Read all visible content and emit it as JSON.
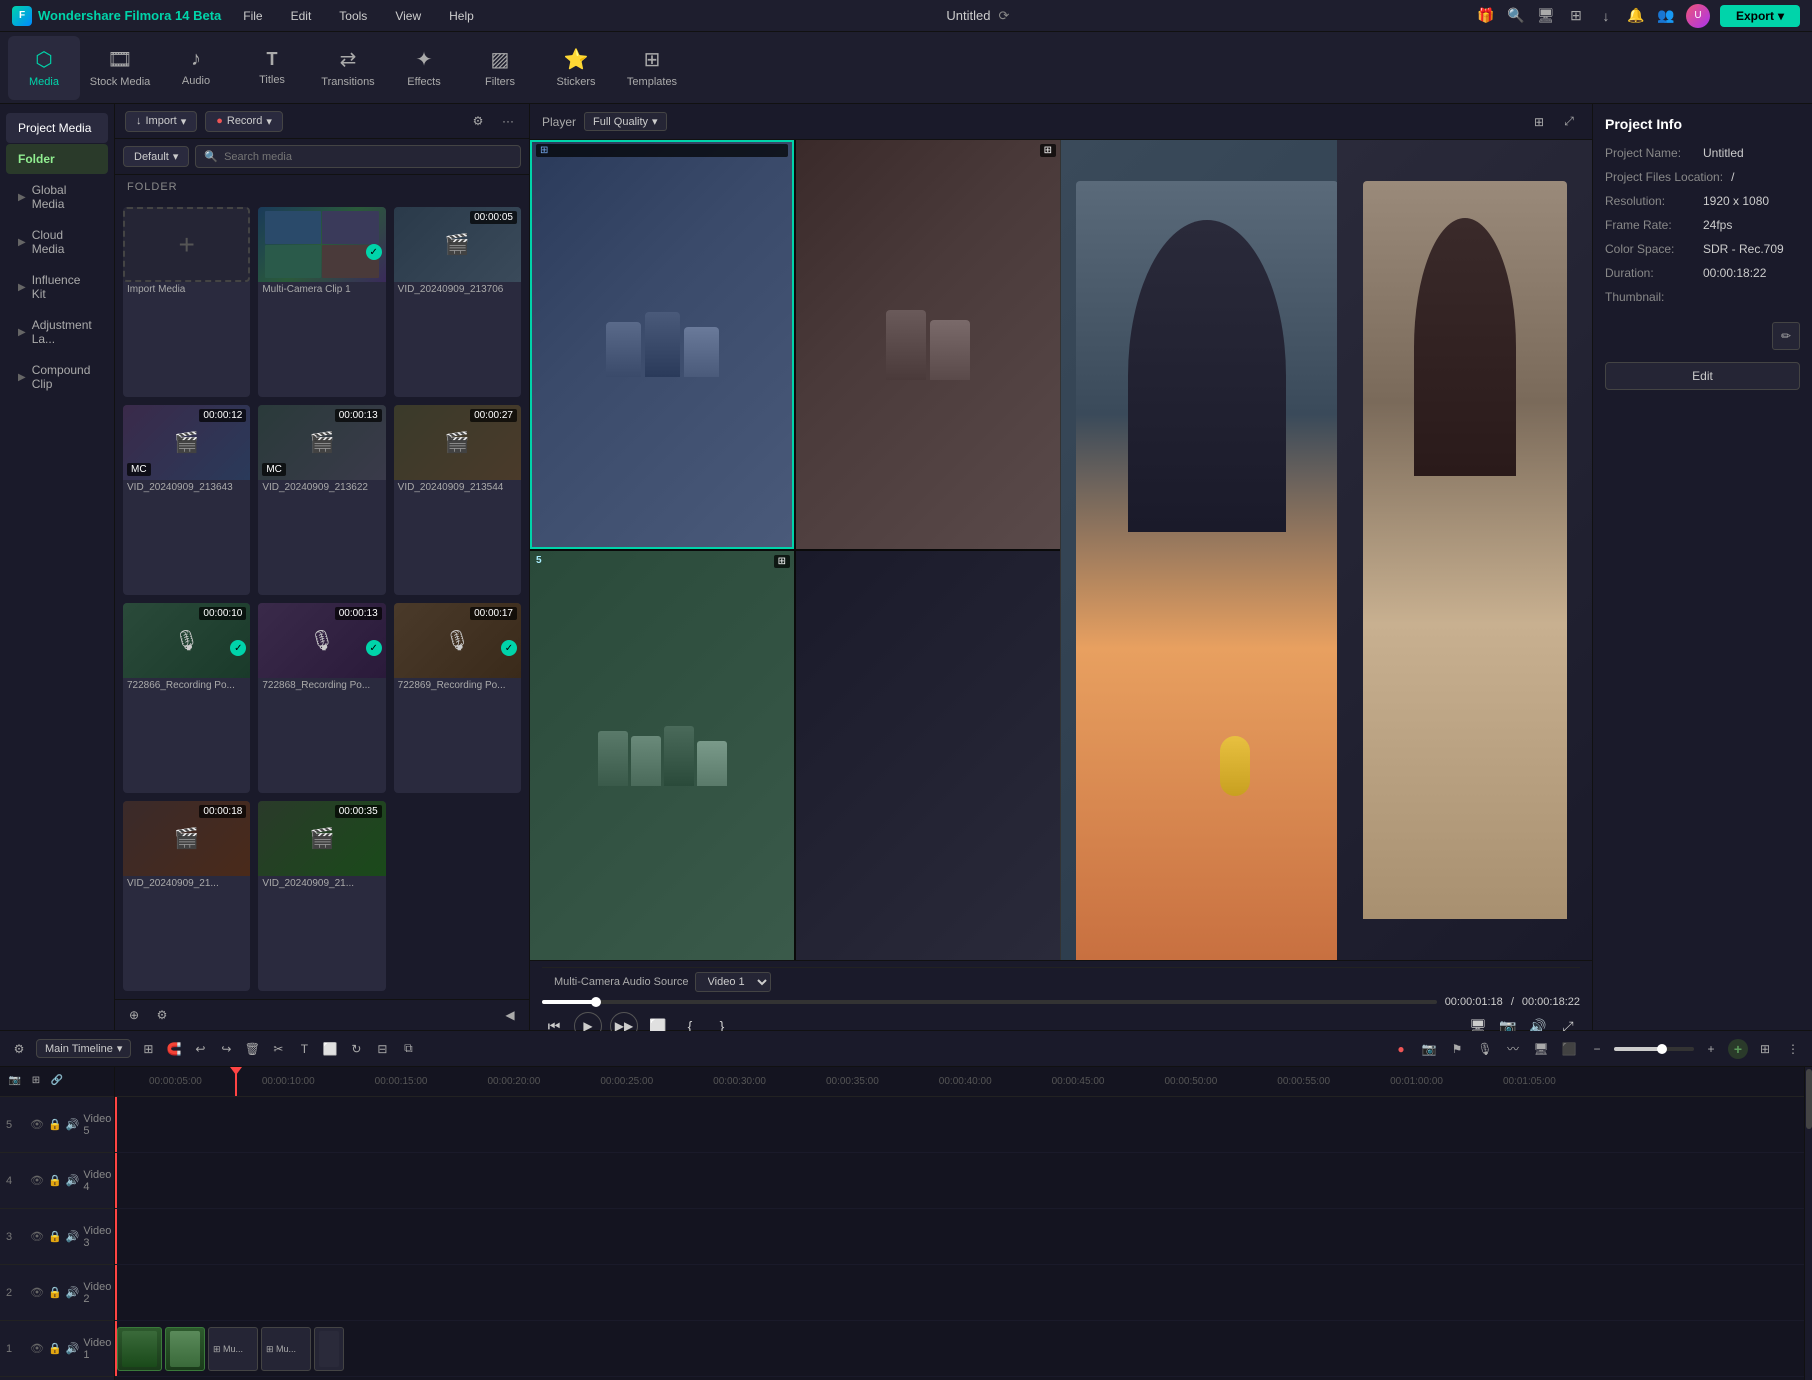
{
  "app": {
    "name": "Wondershare Filmora 14 Beta",
    "title": "Untitled",
    "export_label": "Export"
  },
  "menu": {
    "items": [
      "File",
      "Edit",
      "Tools",
      "View",
      "Help"
    ]
  },
  "toolbar": {
    "items": [
      {
        "id": "media",
        "label": "Media",
        "icon": "🎬",
        "active": true
      },
      {
        "id": "stock_media",
        "label": "Stock Media",
        "icon": "🎞"
      },
      {
        "id": "audio",
        "label": "Audio",
        "icon": "🎵"
      },
      {
        "id": "titles",
        "label": "Titles",
        "icon": "T"
      },
      {
        "id": "transitions",
        "label": "Transitions",
        "icon": "⇄"
      },
      {
        "id": "effects",
        "label": "Effects",
        "icon": "✦"
      },
      {
        "id": "filters",
        "label": "Filters",
        "icon": "▨"
      },
      {
        "id": "stickers",
        "label": "Stickers",
        "icon": "😊"
      },
      {
        "id": "templates",
        "label": "Templates",
        "icon": "⊞"
      }
    ]
  },
  "sidebar": {
    "items": [
      {
        "id": "project_media",
        "label": "Project Media",
        "active": true
      },
      {
        "id": "folder",
        "label": "Folder",
        "folder": true
      },
      {
        "id": "global_media",
        "label": "Global Media"
      },
      {
        "id": "cloud_media",
        "label": "Cloud Media"
      },
      {
        "id": "influence_kit",
        "label": "Influence Kit"
      },
      {
        "id": "adjustment_la",
        "label": "Adjustment La..."
      },
      {
        "id": "compound_clip",
        "label": "Compound Clip"
      }
    ]
  },
  "panel": {
    "import_label": "Import",
    "record_label": "Record",
    "default_label": "Default",
    "search_placeholder": "Search media",
    "folder_label": "FOLDER",
    "import_media_label": "Import Media"
  },
  "media_items": [
    {
      "id": "import",
      "type": "import"
    },
    {
      "id": "multi_cam",
      "label": "Multi-Camera Clip 1",
      "duration": "",
      "has_check": true
    },
    {
      "id": "vid_213706",
      "label": "VID_20240909_213706",
      "duration": "00:00:05"
    },
    {
      "id": "vid_213643",
      "label": "VID_20240909_213643",
      "duration": "00:00:12"
    },
    {
      "id": "vid_213622",
      "label": "VID_20240909_213622",
      "duration": "00:00:13"
    },
    {
      "id": "vid_213544",
      "label": "VID_20240909_213544",
      "duration": "00:00:27"
    },
    {
      "id": "rec_po1",
      "label": "722866_Recording Po...",
      "duration": "00:00:10",
      "has_check": true
    },
    {
      "id": "rec_po2",
      "label": "722868_Recording Po...",
      "duration": "00:00:13",
      "has_check": true
    },
    {
      "id": "rec_po3",
      "label": "722869_Recording Po...",
      "duration": "00:00:17",
      "has_check": true
    },
    {
      "id": "vid_2",
      "label": "VID_20240909_21...",
      "duration": "00:00:18"
    },
    {
      "id": "vid_3",
      "label": "VID_20240909_21...",
      "duration": "00:00:35"
    }
  ],
  "player": {
    "label": "Player",
    "quality": "Full Quality",
    "current_time": "00:00:01:18",
    "total_time": "00:00:18:22",
    "audio_source_label": "Multi-Camera Audio Source",
    "audio_source_value": "Video 1",
    "progress_pct": 6
  },
  "cam_cells": [
    {
      "id": 1,
      "label": ""
    },
    {
      "id": 2,
      "label": ""
    },
    {
      "id": 3,
      "label": "5"
    },
    {
      "id": 4,
      "label": ""
    }
  ],
  "project_info": {
    "title": "Project Info",
    "project_name_label": "Project Name:",
    "project_name_value": "Untitled",
    "files_location_label": "Project Files Location:",
    "files_location_value": "/",
    "resolution_label": "Resolution:",
    "resolution_value": "1920 x 1080",
    "frame_rate_label": "Frame Rate:",
    "frame_rate_value": "24fps",
    "color_space_label": "Color Space:",
    "color_space_value": "SDR - Rec.709",
    "duration_label": "Duration:",
    "duration_value": "00:00:18:22",
    "thumbnail_label": "Thumbnail:",
    "edit_label": "Edit"
  },
  "timeline": {
    "label": "Main Timeline",
    "ruler_marks": [
      "00:00:05:00",
      "00:00:10:00",
      "00:00:15:00",
      "00:00:20:00",
      "00:00:25:00",
      "00:00:30:00",
      "00:00:35:00",
      "00:00:40:00",
      "00:00:45:00",
      "00:00:50:00",
      "00:00:55:00",
      "00:01:00:00",
      "00:01:05:00"
    ],
    "tracks": [
      {
        "id": "v5",
        "num": "5",
        "label": "Video 5"
      },
      {
        "id": "v4",
        "num": "4",
        "label": "Video 4"
      },
      {
        "id": "v3",
        "num": "3",
        "label": "Video 3"
      },
      {
        "id": "v2",
        "num": "2",
        "label": "Video 2"
      },
      {
        "id": "v1",
        "num": "1",
        "label": "Video 1"
      }
    ]
  },
  "colors": {
    "accent": "#00d4aa",
    "bg_dark": "#141420",
    "bg_panel": "#1a1a2a",
    "playhead": "#ff4444"
  }
}
